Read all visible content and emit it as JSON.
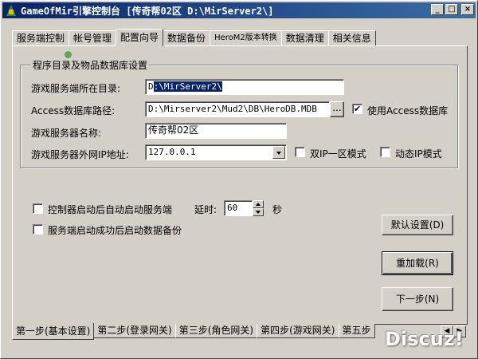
{
  "window": {
    "title": "GameOfMir引擎控制台 [传奇帮02区 D:\\MirServer2\\]",
    "controls": [
      "_",
      "□",
      "×"
    ]
  },
  "tabs_top": [
    {
      "label": "服务端控制",
      "active": false
    },
    {
      "label": "帐号管理",
      "active": false
    },
    {
      "label": "配置向导",
      "active": true
    },
    {
      "label": "数据备份",
      "active": false
    },
    {
      "label": "HeroM2版本转换",
      "active": false
    },
    {
      "label": "数据清理",
      "active": false
    },
    {
      "label": "相关信息",
      "active": false
    }
  ],
  "group": {
    "title": "程序目录及物品数据库设置"
  },
  "fields": {
    "server_dir_label": "游戏服务端所在目录:",
    "server_dir_value_prefix": "D",
    "server_dir_value_sel": ":\\MirServer2\\",
    "access_path_label": "Access数据库路径:",
    "access_path_value": "D:\\Mirserver2\\Mud2\\DB\\HeroDB.MDB",
    "browse_label": "...",
    "use_access_label": "使用Access数据库",
    "use_access_checked": "✔",
    "server_name_label": "游戏服务器名称:",
    "server_name_value": "传奇帮02区",
    "ip_label": "游戏服务器外网IP地址:",
    "ip_value": "127.0.0.1",
    "dual_ip_label": "双IP一区模式",
    "dynamic_ip_label": "动态IP模式"
  },
  "options": {
    "auto_start_label": "控制器启动后自动启动服务端",
    "delay_label": "延时:",
    "delay_value": "60",
    "delay_unit": "秒",
    "auto_backup_label": "服务端启动成功后启动数据备份"
  },
  "buttons": {
    "default_settings": "默认设置(D)",
    "reload": "重加载(R)",
    "next": "下一步(N)"
  },
  "tabs_bottom": [
    {
      "label": "第一步(基本设置)",
      "active": true
    },
    {
      "label": "第二步(登录网关)",
      "active": false
    },
    {
      "label": "第三步(角色网关)",
      "active": false
    },
    {
      "label": "第四步(游戏网关)",
      "active": false
    },
    {
      "label": "第五步",
      "active": false
    }
  ],
  "watermark": "Discuz!",
  "icons": {
    "app": "mir-app-icon",
    "combo": "chevron-down-icon"
  }
}
